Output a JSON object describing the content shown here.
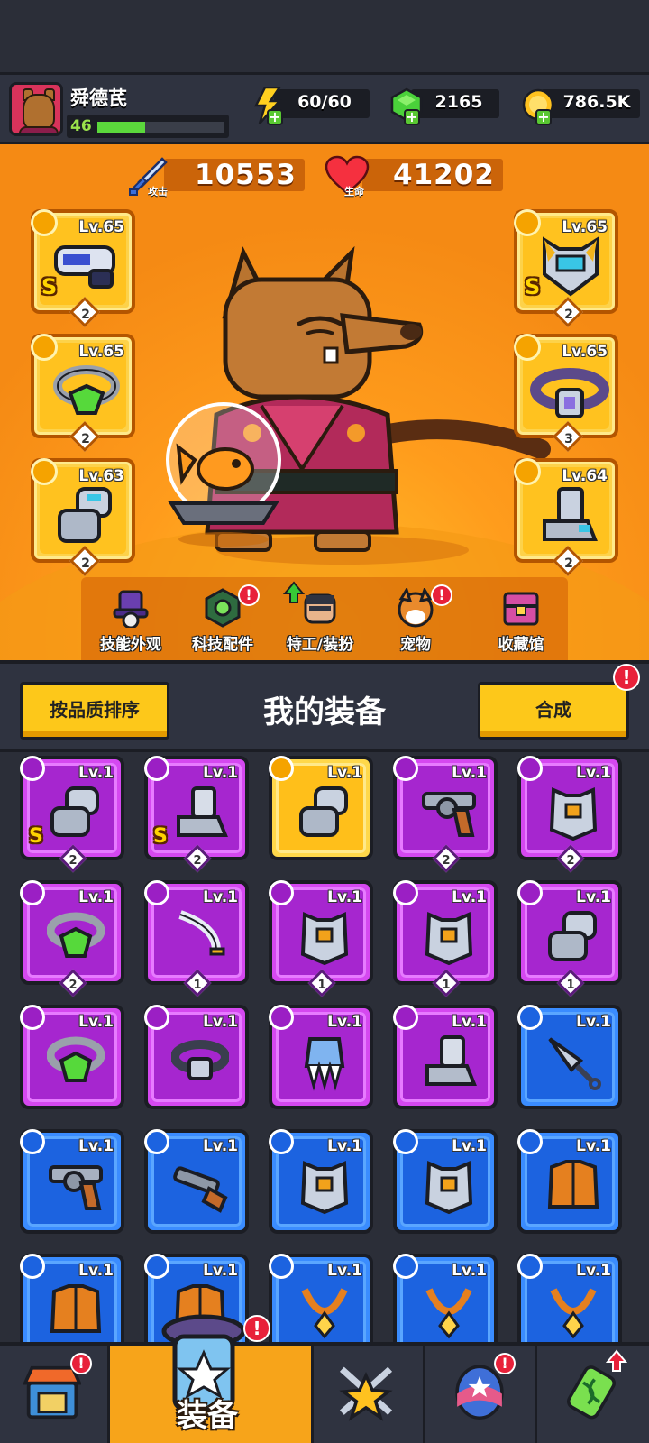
{
  "player": {
    "name": "舜德芪",
    "level": "46",
    "xp_fraction": 0.38
  },
  "resources": {
    "energy": "60/60",
    "gems": "2165",
    "coins": "786.5K"
  },
  "stats": {
    "attack_label": "攻击",
    "attack_value": "10553",
    "hp_label": "生命",
    "hp_value": "41202"
  },
  "equipped": {
    "left": [
      {
        "level": "Lv.65",
        "stars": "2",
        "rank": "S",
        "icon": "blaster-weapon-icon"
      },
      {
        "level": "Lv.65",
        "stars": "2",
        "rank": "",
        "icon": "gem-ring-icon"
      },
      {
        "level": "Lv.63",
        "stars": "2",
        "rank": "",
        "icon": "gauntlet-icon"
      }
    ],
    "right": [
      {
        "level": "Lv.65",
        "stars": "2",
        "rank": "S",
        "icon": "robot-armor-icon"
      },
      {
        "level": "Lv.65",
        "stars": "3",
        "rank": "",
        "icon": "belt-icon"
      },
      {
        "level": "Lv.64",
        "stars": "2",
        "rank": "",
        "icon": "boot-icon"
      }
    ]
  },
  "hero_nav": [
    {
      "label": "技能外观",
      "icon": "hat-icon",
      "badge": false
    },
    {
      "label": "科技配件",
      "icon": "hex-chip-icon",
      "badge": true
    },
    {
      "label": "特工/装扮",
      "icon": "agent-icon",
      "badge": false
    },
    {
      "label": "宠物",
      "icon": "dog-icon",
      "badge": true
    },
    {
      "label": "收藏馆",
      "icon": "chest-icon",
      "badge": false
    }
  ],
  "my_equipment": {
    "sort_label": "按品质排序",
    "title": "我的装备",
    "merge_label": "合成",
    "merge_badge": "!",
    "items": [
      {
        "rarity": "purple",
        "level": "Lv.1",
        "stars": "2",
        "rank": "S",
        "icon": "gauntlet-icon"
      },
      {
        "rarity": "purple",
        "level": "Lv.1",
        "stars": "2",
        "rank": "S",
        "icon": "boot-icon"
      },
      {
        "rarity": "gold",
        "level": "Lv.1",
        "stars": "",
        "rank": "",
        "icon": "gauntlet-icon"
      },
      {
        "rarity": "purple",
        "level": "Lv.1",
        "stars": "2",
        "rank": "",
        "icon": "revolver-icon"
      },
      {
        "rarity": "purple",
        "level": "Lv.1",
        "stars": "2",
        "rank": "",
        "icon": "armor-vest-icon"
      },
      {
        "rarity": "purple",
        "level": "Lv.1",
        "stars": "2",
        "rank": "",
        "icon": "gem-ring-icon"
      },
      {
        "rarity": "purple",
        "level": "Lv.1",
        "stars": "1",
        "rank": "",
        "icon": "sword-icon"
      },
      {
        "rarity": "purple",
        "level": "Lv.1",
        "stars": "1",
        "rank": "",
        "icon": "armor-vest-icon"
      },
      {
        "rarity": "purple",
        "level": "Lv.1",
        "stars": "1",
        "rank": "",
        "icon": "armor-vest-icon"
      },
      {
        "rarity": "purple",
        "level": "Lv.1",
        "stars": "1",
        "rank": "",
        "icon": "gauntlet-icon"
      },
      {
        "rarity": "purple",
        "level": "Lv.1",
        "stars": "",
        "rank": "",
        "icon": "gem-ring-icon"
      },
      {
        "rarity": "purple",
        "level": "Lv.1",
        "stars": "",
        "rank": "",
        "icon": "belt-icon"
      },
      {
        "rarity": "purple",
        "level": "Lv.1",
        "stars": "",
        "rank": "",
        "icon": "claw-glove-icon"
      },
      {
        "rarity": "purple",
        "level": "Lv.1",
        "stars": "",
        "rank": "",
        "icon": "boot-icon"
      },
      {
        "rarity": "blue",
        "level": "Lv.1",
        "stars": "",
        "rank": "",
        "icon": "kunai-icon"
      },
      {
        "rarity": "blue",
        "level": "Lv.1",
        "stars": "",
        "rank": "",
        "icon": "revolver-icon"
      },
      {
        "rarity": "blue",
        "level": "Lv.1",
        "stars": "",
        "rank": "",
        "icon": "shotgun-icon"
      },
      {
        "rarity": "blue",
        "level": "Lv.1",
        "stars": "",
        "rank": "",
        "icon": "armor-vest-icon"
      },
      {
        "rarity": "blue",
        "level": "Lv.1",
        "stars": "",
        "rank": "",
        "icon": "armor-vest-icon"
      },
      {
        "rarity": "blue",
        "level": "Lv.1",
        "stars": "",
        "rank": "",
        "icon": "jacket-icon"
      },
      {
        "rarity": "blue",
        "level": "Lv.1",
        "stars": "",
        "rank": "",
        "icon": "jacket-icon"
      },
      {
        "rarity": "blue",
        "level": "Lv.1",
        "stars": "",
        "rank": "",
        "icon": "jacket-icon"
      },
      {
        "rarity": "blue",
        "level": "Lv.1",
        "stars": "",
        "rank": "",
        "icon": "necklace-icon"
      },
      {
        "rarity": "blue",
        "level": "Lv.1",
        "stars": "",
        "rank": "",
        "icon": "necklace-icon"
      },
      {
        "rarity": "blue",
        "level": "Lv.1",
        "stars": "",
        "rank": "",
        "icon": "necklace-icon"
      }
    ]
  },
  "bottom_nav": [
    {
      "label": "",
      "icon": "shop-icon",
      "badge": true
    },
    {
      "label": "装备",
      "icon": "equipment-icon",
      "badge": true,
      "active": true
    },
    {
      "label": "",
      "icon": "battle-star-icon",
      "badge": false
    },
    {
      "label": "",
      "icon": "egg-icon",
      "badge": true
    },
    {
      "label": "",
      "icon": "dna-icon",
      "badge": false
    }
  ],
  "colors": {
    "purple_rarity": "#a626cf",
    "blue_rarity": "#1c63e0",
    "gold_rarity": "#ffbf1a",
    "badge_red": "#e8213a"
  }
}
